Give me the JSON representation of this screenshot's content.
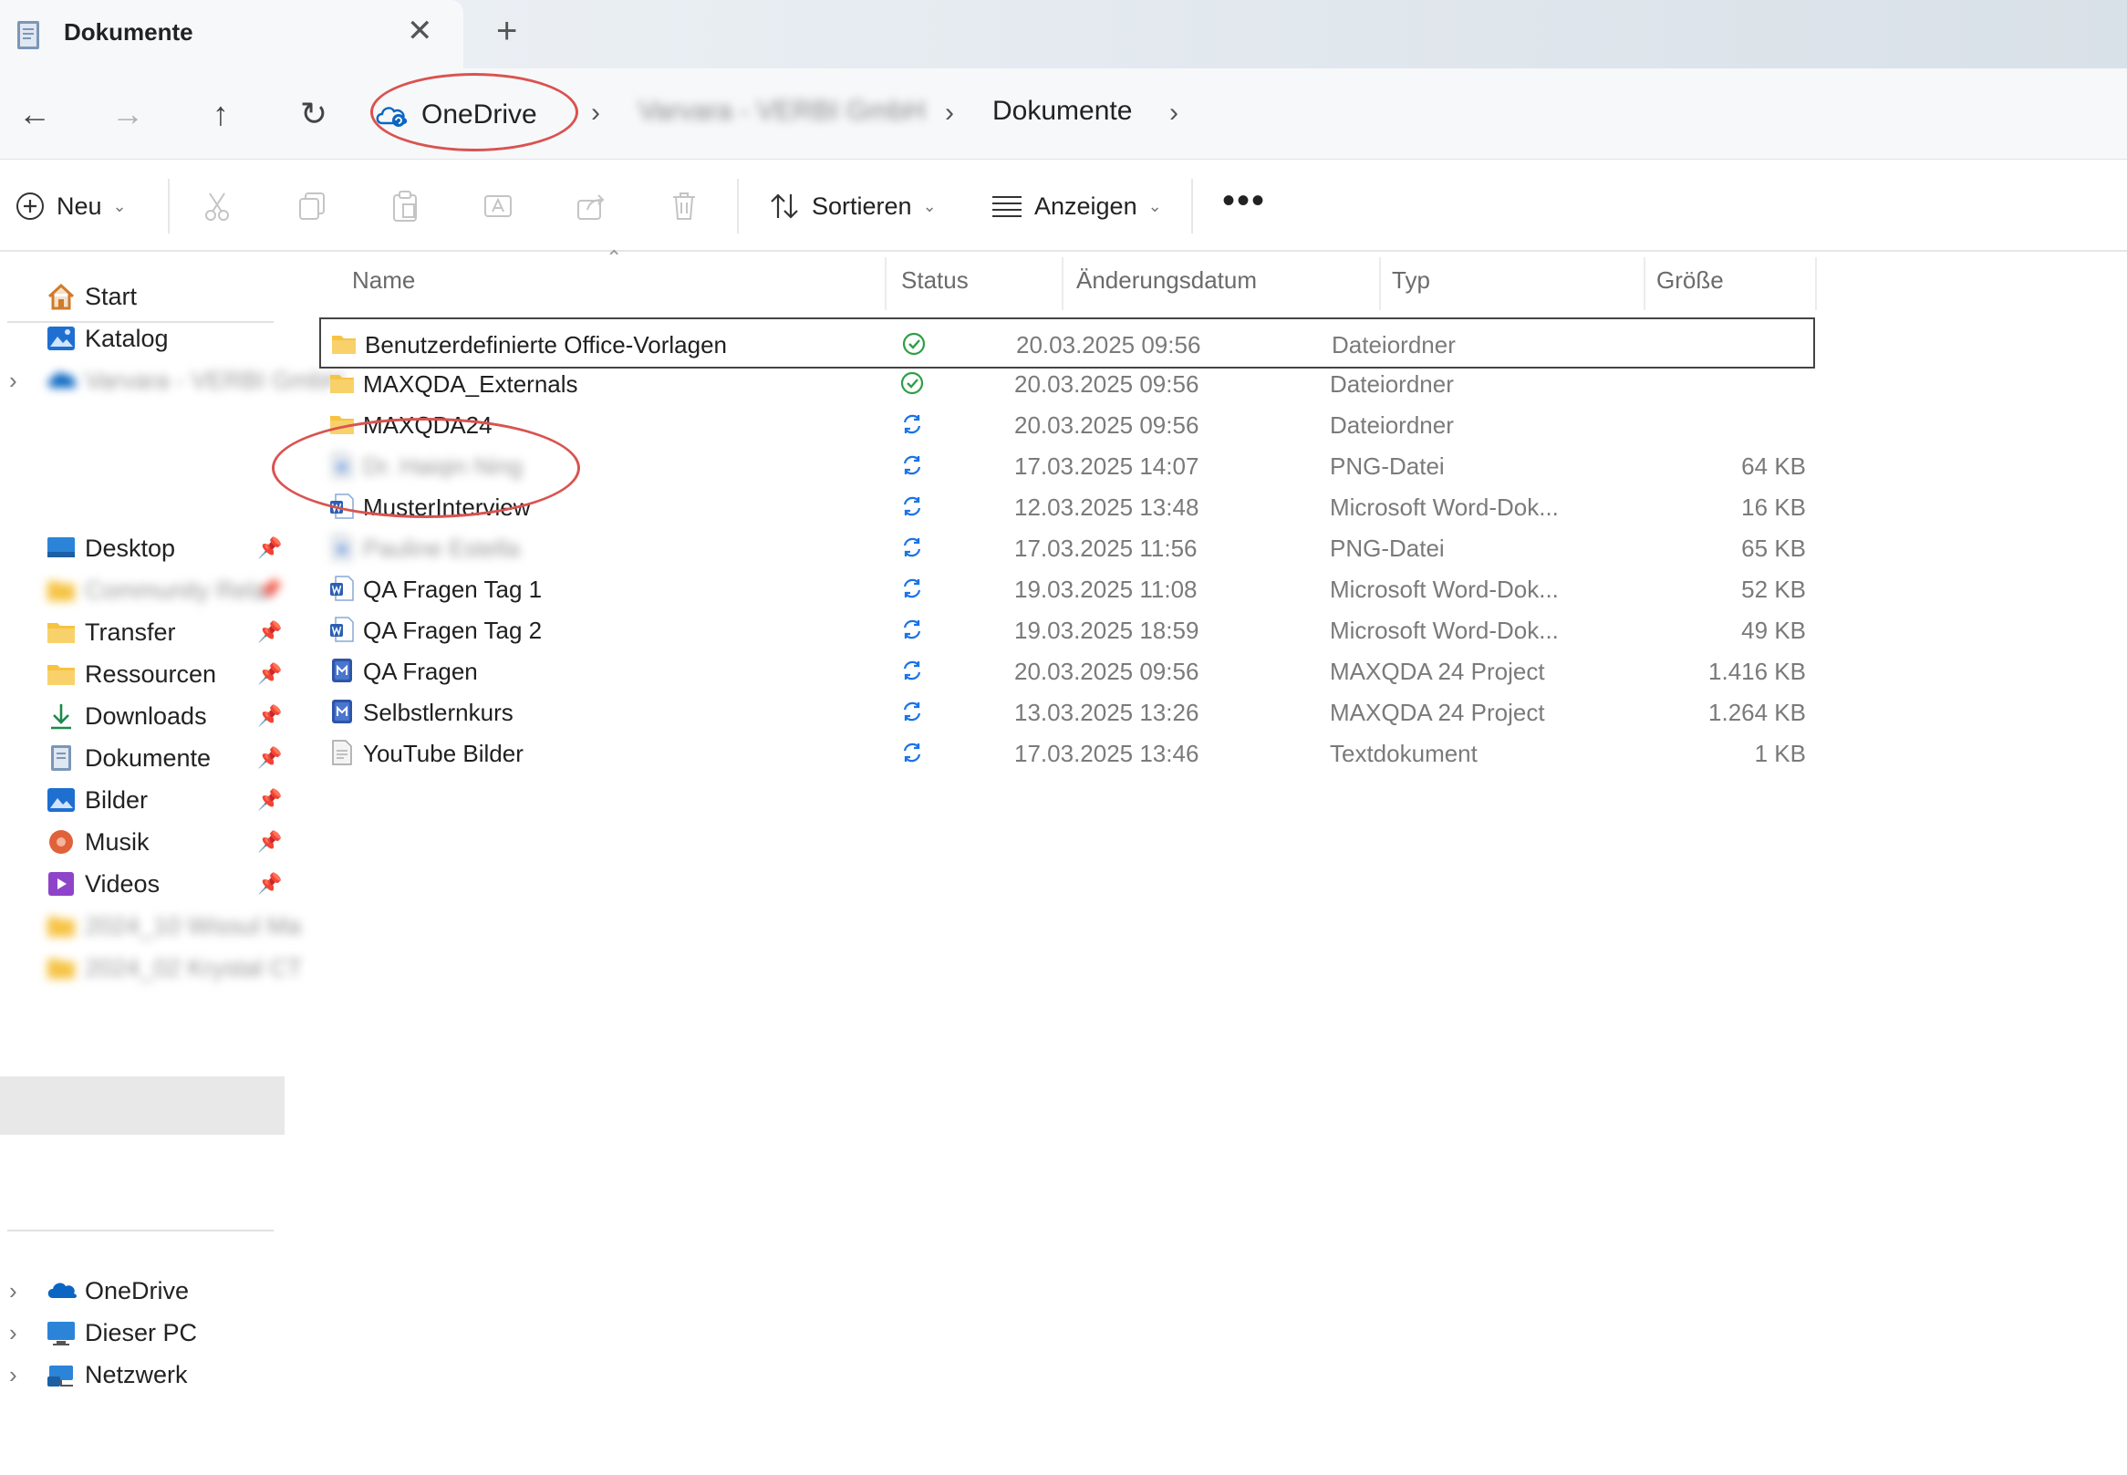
{
  "window": {
    "tab_title": "Dokumente",
    "tab_close": "✕",
    "new_tab": "+"
  },
  "address": {
    "back": "←",
    "forward": "→",
    "up": "↑",
    "refresh": "↻",
    "crumbs": [
      "OneDrive",
      "Varvara - VERBI GmbH",
      "Dokumente"
    ],
    "separator": "›"
  },
  "toolbar": {
    "new_label": "Neu",
    "sort_label": "Sortieren",
    "view_label": "Anzeigen",
    "more_label": "•••",
    "chevron": "⌄"
  },
  "sidebar": {
    "top_items": [
      {
        "label": "Start",
        "icon": "home-icon"
      },
      {
        "label": "Katalog",
        "icon": "gallery-icon"
      },
      {
        "label": "Varvara - VERBI GmbH",
        "icon": "onedrive-cloud-icon",
        "blurred": true
      }
    ],
    "quick_access": [
      {
        "label": "Desktop",
        "icon": "desktop-icon",
        "pinned": true
      },
      {
        "label": "Community Rela",
        "icon": "folder-icon",
        "pinned": true,
        "blurred": true
      },
      {
        "label": "Transfer",
        "icon": "folder-icon",
        "pinned": true
      },
      {
        "label": "Ressourcen",
        "icon": "folder-icon",
        "pinned": true
      },
      {
        "label": "Downloads",
        "icon": "download-icon",
        "pinned": true
      },
      {
        "label": "Dokumente",
        "icon": "documents-icon",
        "pinned": true,
        "active": true
      },
      {
        "label": "Bilder",
        "icon": "pictures-icon",
        "pinned": true
      },
      {
        "label": "Musik",
        "icon": "music-icon",
        "pinned": true
      },
      {
        "label": "Videos",
        "icon": "videos-icon",
        "pinned": true
      },
      {
        "label": "2024_10 Wissul Ma",
        "icon": "folder-icon",
        "blurred": true
      },
      {
        "label": "2024_02 Krystal CT",
        "icon": "folder-icon",
        "blurred": true
      }
    ],
    "bottom_items": [
      {
        "label": "OneDrive",
        "icon": "onedrive-cloud-icon"
      },
      {
        "label": "Dieser PC",
        "icon": "pc-icon"
      },
      {
        "label": "Netzwerk",
        "icon": "network-icon"
      }
    ],
    "pin_glyph": "📌",
    "expand_glyph": "›"
  },
  "filelist": {
    "columns": {
      "name": "Name",
      "status": "Status",
      "date": "Änderungsdatum",
      "type": "Typ",
      "size": "Größe"
    },
    "sort_caret": "⌃",
    "rows": [
      {
        "name": "Benutzerdefinierte Office-Vorlagen",
        "status": "synced",
        "date": "20.03.2025 09:56",
        "type": "Dateiordner",
        "size": "",
        "icon": "folder-icon",
        "selected": true
      },
      {
        "name": "MAXQDA_Externals",
        "status": "synced",
        "date": "20.03.2025 09:56",
        "type": "Dateiordner",
        "size": "",
        "icon": "folder-icon"
      },
      {
        "name": "MAXQDA24",
        "status": "syncing",
        "date": "20.03.2025 09:56",
        "type": "Dateiordner",
        "size": "",
        "icon": "folder-icon"
      },
      {
        "name": "Dr. Haiqin Ning",
        "status": "syncing",
        "date": "17.03.2025 14:07",
        "type": "PNG-Datei",
        "size": "64 KB",
        "icon": "png-file-icon",
        "blurred": true
      },
      {
        "name": "MusterInterview",
        "status": "syncing",
        "date": "12.03.2025 13:48",
        "type": "Microsoft Word-Dok...",
        "size": "16 KB",
        "icon": "word-file-icon"
      },
      {
        "name": "Pauline Estella",
        "status": "syncing",
        "date": "17.03.2025 11:56",
        "type": "PNG-Datei",
        "size": "65 KB",
        "icon": "png-file-icon",
        "blurred": true
      },
      {
        "name": "QA Fragen Tag 1",
        "status": "syncing",
        "date": "19.03.2025 11:08",
        "type": "Microsoft Word-Dok...",
        "size": "52 KB",
        "icon": "word-file-icon"
      },
      {
        "name": "QA Fragen Tag 2",
        "status": "syncing",
        "date": "19.03.2025 18:59",
        "type": "Microsoft Word-Dok...",
        "size": "49 KB",
        "icon": "word-file-icon"
      },
      {
        "name": "QA Fragen",
        "status": "syncing",
        "date": "20.03.2025 09:56",
        "type": "MAXQDA 24 Project",
        "size": "1.416 KB",
        "icon": "maxqda-project-icon"
      },
      {
        "name": "Selbstlernkurs",
        "status": "syncing",
        "date": "13.03.2025 13:26",
        "type": "MAXQDA 24 Project",
        "size": "1.264 KB",
        "icon": "maxqda-project-icon"
      },
      {
        "name": "YouTube Bilder",
        "status": "syncing",
        "date": "17.03.2025 13:46",
        "type": "Textdokument",
        "size": "1 KB",
        "icon": "text-file-icon"
      }
    ]
  },
  "annotations": {
    "highlight_color": "#d9534f"
  },
  "colors": {
    "accent": "#0067c0",
    "sync_ok": "#2e9e47",
    "sync_pending": "#1a73e8",
    "folder": "#f6c343"
  }
}
